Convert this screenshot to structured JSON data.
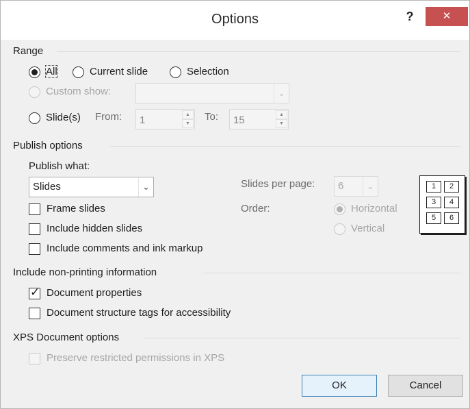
{
  "window": {
    "title": "Options",
    "help_glyph": "?",
    "close_glyph": "✕"
  },
  "range": {
    "title": "Range",
    "all_label": "All",
    "current_slide_label": "Current slide",
    "selection_label": "Selection",
    "custom_show_label": "Custom show:",
    "slides_label": "Slide(s)",
    "from_label": "From:",
    "from_value": "1",
    "to_label": "To:",
    "to_value": "15",
    "selected": "All"
  },
  "publish": {
    "title": "Publish options",
    "what_label": "Publish what:",
    "what_value": "Slides",
    "frame_slides": "Frame slides",
    "include_hidden": "Include hidden slides",
    "include_comments": "Include comments and ink markup",
    "slides_per_page_label": "Slides per page:",
    "slides_per_page_value": "6",
    "order_label": "Order:",
    "horizontal_label": "Horizontal",
    "vertical_label": "Vertical",
    "order_selected": "Horizontal",
    "preview_cells": [
      "1",
      "2",
      "3",
      "4",
      "5",
      "6"
    ]
  },
  "non_printing": {
    "title": "Include non-printing information",
    "document_properties": "Document properties",
    "document_properties_checked": true,
    "structure_tags": "Document structure tags for accessibility",
    "structure_tags_checked": false
  },
  "xps": {
    "title": "XPS Document options",
    "preserve_permissions": "Preserve restricted permissions in XPS"
  },
  "buttons": {
    "ok": "OK",
    "cancel": "Cancel"
  },
  "colors": {
    "close_button": "#c75050",
    "dialog_bg": "#f0f0f0",
    "default_button_border": "#3c7fb1"
  }
}
